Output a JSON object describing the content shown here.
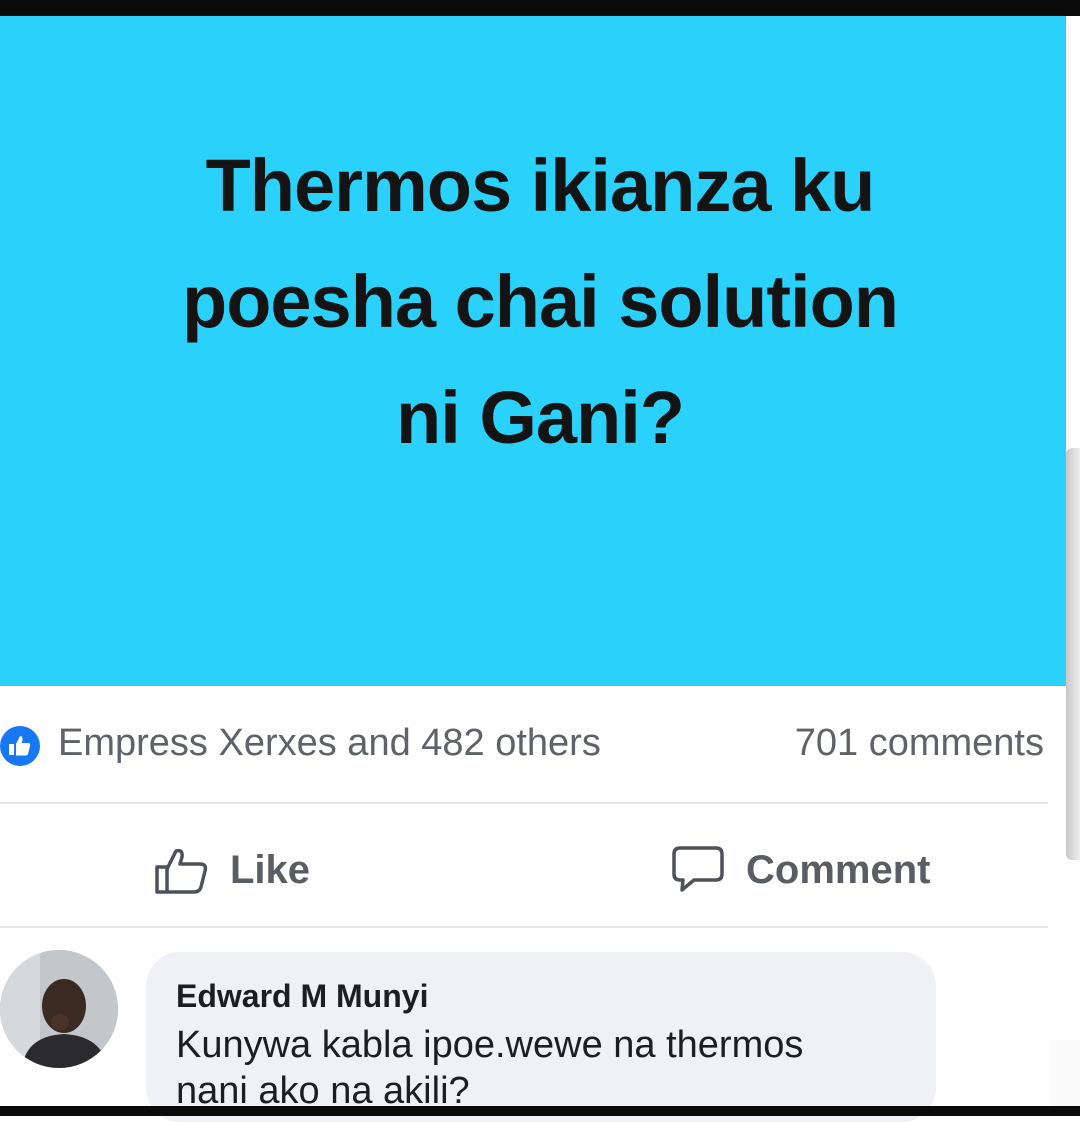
{
  "post": {
    "lines": [
      "Thermos ikianza ku",
      "poesha chai solution",
      "ni Gani?"
    ],
    "background_color": "#2ad1fb"
  },
  "reactions": {
    "icon": "like-icon",
    "text": "Empress Xerxes and 482 others",
    "comments_count": "701 comments"
  },
  "actions": {
    "like_label": "Like",
    "comment_label": "Comment"
  },
  "comment": {
    "author": "Edward M Munyi",
    "lines": [
      "Kunywa kabla ipoe.wewe na thermos",
      "nani ako na akili?"
    ]
  }
}
